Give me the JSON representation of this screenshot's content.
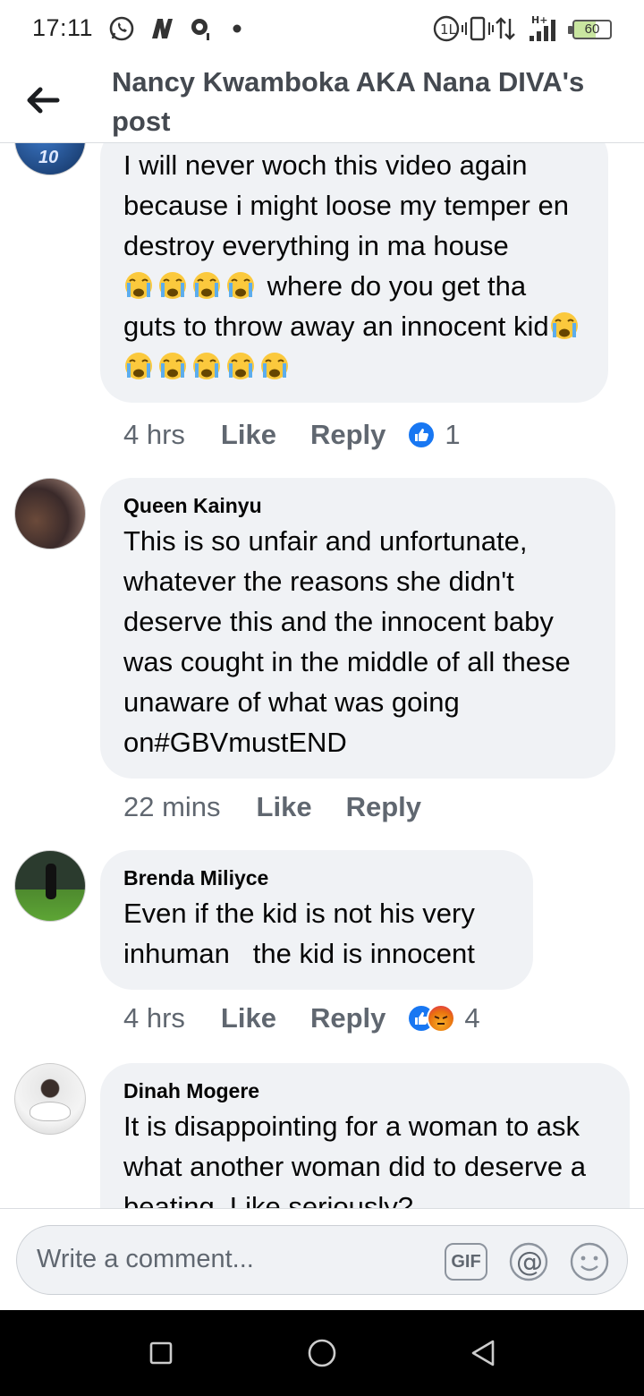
{
  "status_bar": {
    "time": "17:11",
    "battery": "60",
    "network": "H+"
  },
  "header": {
    "title": "Nancy Kwamboka AKA Nana DIVA's post"
  },
  "comments": [
    {
      "author": "",
      "text": "I will never woch this video again because i might loose my temper en destroy everything in ma house",
      "text_after_emoji": " where do you get tha guts to throw away an innocent kid",
      "emoji_name": "loudly-crying-face",
      "time": "4 hrs",
      "like_label": "Like",
      "reply_label": "Reply",
      "reaction_count": "1"
    },
    {
      "author": "Queen Kainyu",
      "text": "This is so unfair and unfortunate, whatever the reasons she didn't deserve this and the innocent baby was cought in the middle of all these unaware of what was going on#GBVmustEND",
      "time": "22 mins",
      "like_label": "Like",
      "reply_label": "Reply"
    },
    {
      "author": "Brenda Miliyce",
      "text": "Even if the kid is not his very inhuman   the kid is innocent",
      "time": "4 hrs",
      "like_label": "Like",
      "reply_label": "Reply",
      "reaction_count": "4"
    },
    {
      "author": "Dinah Mogere",
      "text": "It is disappointing for a woman to ask what another woman did to deserve a beating. Like seriously?"
    }
  ],
  "composer": {
    "placeholder": "Write a comment...",
    "gif_label": "GIF"
  },
  "icons": {
    "back": "arrow-left-icon",
    "like": "thumbs-up-icon",
    "angry": "angry-face-icon",
    "mention": "at-sign-icon",
    "emoji": "smiley-icon"
  },
  "colors": {
    "facebook_blue": "#1877f2",
    "bubble_bg": "#f0f2f5",
    "meta_gray": "#606770"
  }
}
